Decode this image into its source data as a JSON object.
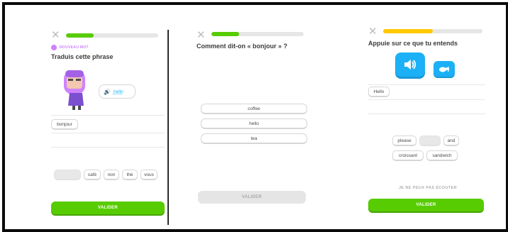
{
  "colors": {
    "green": "#58cc02",
    "yellow": "#ffc800",
    "blue": "#1cb0f6",
    "purple": "#ce82ff"
  },
  "screen1": {
    "close_icon": "close-icon",
    "progress": 0.3,
    "badge_label": "NOUVEAU MOT",
    "title": "Traduis cette phrase",
    "speech_word": "hello",
    "answer_chip": "bonjour",
    "word_bank": [
      "",
      "café",
      "non",
      "thé",
      "vous"
    ],
    "button_label": "VALIDER"
  },
  "screen2": {
    "close_icon": "close-icon",
    "progress": 0.3,
    "title": "Comment dit-on « bonjour » ?",
    "options": [
      "coffee",
      "hello",
      "tea"
    ],
    "button_label": "VALIDER"
  },
  "screen3": {
    "close_icon": "close-icon",
    "progress": 0.5,
    "title": "Appuie sur ce que tu entends",
    "answer_chip": "Hello",
    "word_bank_row1": [
      "please",
      "",
      "and"
    ],
    "word_bank_row2": [
      "croissant",
      "sandwich"
    ],
    "cant_listen": "JE NE PEUX PAS ÉCOUTER",
    "button_label": "VALIDER"
  }
}
